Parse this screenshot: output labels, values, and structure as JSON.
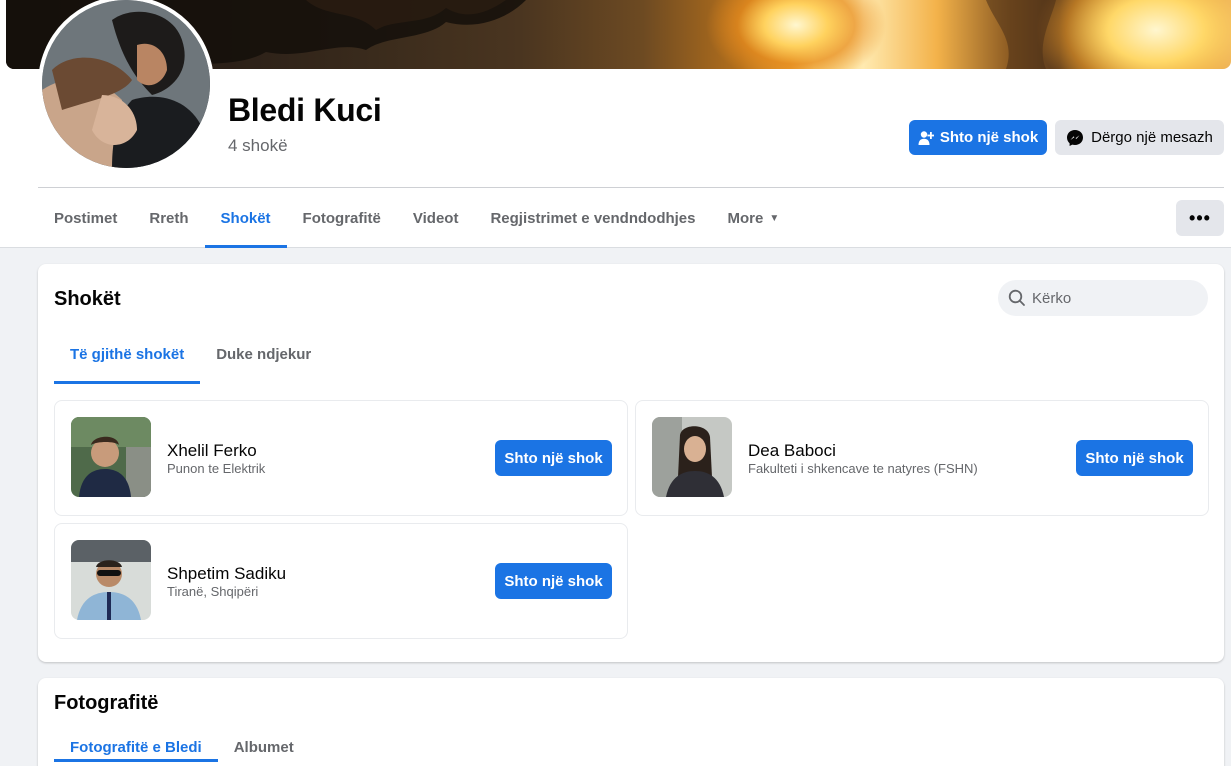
{
  "profile": {
    "name": "Bledi Kuci",
    "friend_count": "4 shokë",
    "add_friend_label": "Shto një shok",
    "message_label": "Dërgo një mesazh"
  },
  "nav": {
    "tabs": [
      "Postimet",
      "Rreth",
      "Shokët",
      "Fotografitë",
      "Videot",
      "Regjistrimet e vendndodhjes",
      "More"
    ],
    "active_tab": "Shokët",
    "more_options": "•••"
  },
  "friends_section": {
    "title": "Shokët",
    "search_placeholder": "Kërko",
    "subtabs": [
      "Të gjithë shokët",
      "Duke ndjekur"
    ],
    "active_subtab": "Të gjithë shokët",
    "friends": [
      {
        "name": "Xhelil Ferko",
        "subtitle": "Punon te Elektrik",
        "button_label": "Shto një shok"
      },
      {
        "name": "Dea Baboci",
        "subtitle": "Fakulteti i shkencave te natyres (FSHN)",
        "button_label": "Shto një shok"
      },
      {
        "name": "Shpetim Sadiku",
        "subtitle": "Tiranë, Shqipëri",
        "button_label": "Shto një shok"
      }
    ]
  },
  "photos_section": {
    "title": "Fotografitë",
    "subtabs": [
      "Fotografitë e Bledi",
      "Albumet"
    ],
    "active_subtab": "Fotografitë e Bledi"
  },
  "colors": {
    "accent": "#1b74e4",
    "page_background": "#f0f2f5",
    "secondary_text": "#65676b",
    "secondary_button": "#e4e6eb"
  }
}
